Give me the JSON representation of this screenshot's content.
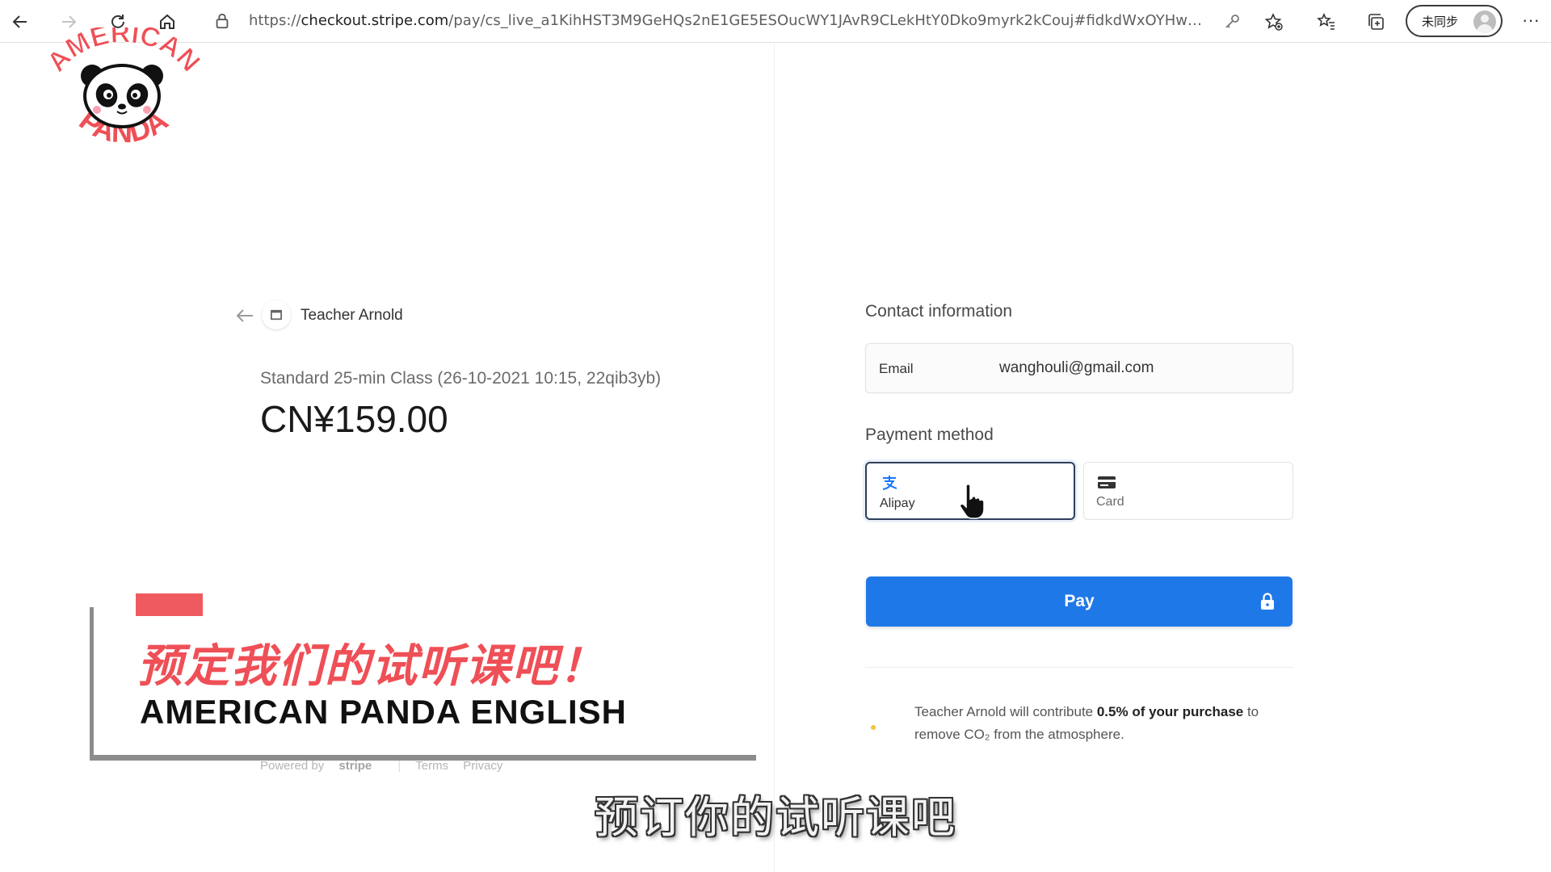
{
  "browser": {
    "url_prefix": "https://",
    "url_host": "checkout.stripe.com",
    "url_rest": "/pay/cs_live_a1KihHST3M9GeHQs2nE1GE5ESOucWY1JAvR9CLekHtY0Dko9myrk2kCouj#fidkdWxOYHwnPyd1b...",
    "profile_label": "未同步",
    "more_label": "···"
  },
  "logo": {
    "top_text": "AMERICAN",
    "bottom_text": "PANDA"
  },
  "product": {
    "merchant": "Teacher Arnold",
    "name": "Standard 25-min Class (26-10-2021 10:15, 22qib3yb)",
    "price": "CN¥159.00"
  },
  "footer": {
    "powered_by": "Powered by",
    "brand": "stripe",
    "terms": "Terms",
    "privacy": "Privacy"
  },
  "checkout": {
    "contact_heading": "Contact information",
    "email_label": "Email",
    "email_value": "wanghouli@gmail.com",
    "payment_heading": "Payment method",
    "methods": [
      {
        "label": "Alipay",
        "selected": true,
        "icon": "alipay-icon"
      },
      {
        "label": "Card",
        "selected": false,
        "icon": "card-icon"
      }
    ],
    "pay_label": "Pay",
    "climate_pre": "Teacher Arnold will contribute ",
    "climate_bold": "0.5% of your purchase",
    "climate_post": " to remove CO₂ from the atmosphere."
  },
  "banner": {
    "cn_text": "预定我们的试听课吧！",
    "en_text": "AMERICAN PANDA ENGLISH"
  },
  "subtitle": "预订你的试听课吧",
  "colors": {
    "pay_button": "#1f78e8",
    "banner_accent": "#ef4f56",
    "banner_frame": "#8c8c8c"
  }
}
